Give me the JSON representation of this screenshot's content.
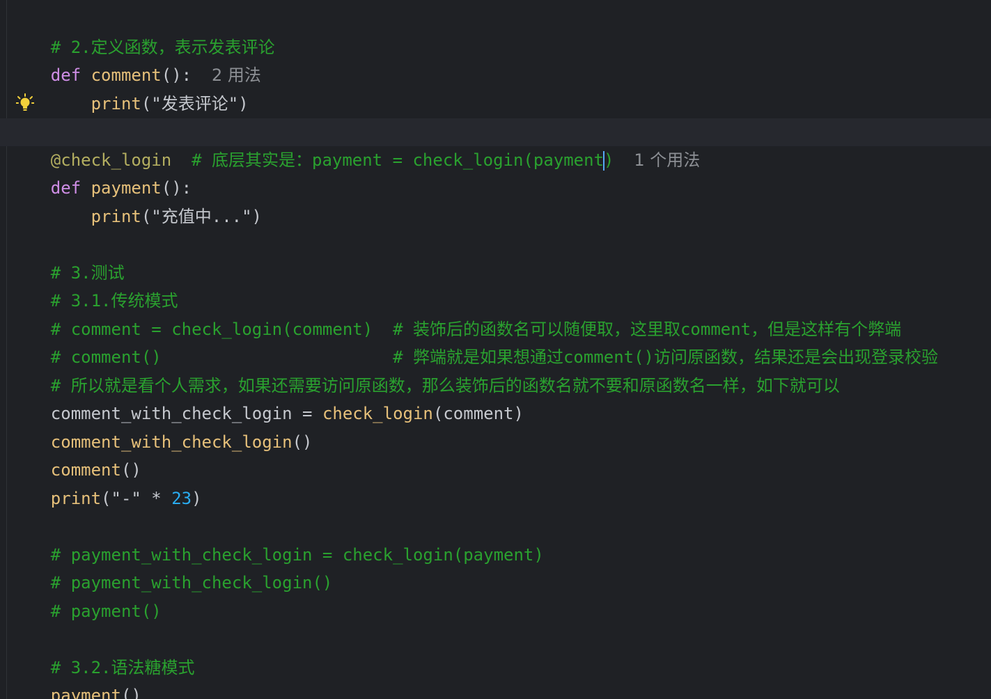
{
  "editor": {
    "lines": [
      {
        "comment": "# 2.定义函数，表示发表评论"
      },
      {
        "kw": "def",
        "name": "comment",
        "paren": "():",
        "hint": "2 用法"
      },
      {
        "indent": "    ",
        "call": "print",
        "open": "(",
        "str": "\"发表评论\"",
        "close": ")"
      },
      {},
      {
        "decorator": "@check_login",
        "gap": "  ",
        "comment_a": "# 底层其实是：payment = check_login(payment",
        "comment_b": ")",
        "hint": "1 个用法"
      },
      {
        "kw": "def",
        "name": "payment",
        "paren": "():"
      },
      {
        "indent": "    ",
        "call": "print",
        "open": "(",
        "str": "\"充值中...\"",
        "close": ")"
      },
      {},
      {
        "comment": "# 3.测试"
      },
      {
        "comment": "# 3.1.传统模式"
      },
      {
        "comment": "# comment = check_login(comment)  # 装饰后的函数名可以随便取，这里取comment，但是这样有个弊端"
      },
      {
        "comment": "# comment()                       # 弊端就是如果想通过comment()访问原函数，结果还是会出现登录校验"
      },
      {
        "comment": "# 所以就是看个人需求，如果还需要访问原函数，那么装饰后的函数名就不要和原函数名一样，如下就可以"
      },
      {
        "var": "comment_with_check_login",
        "op": " = ",
        "call": "check_login",
        "open": "(",
        "arg": "comment",
        "close": ")"
      },
      {
        "call": "comment_with_check_login",
        "parens": "()"
      },
      {
        "call": "comment",
        "parens": "()"
      },
      {
        "call": "print",
        "open": "(",
        "str": "\"-\"",
        "op": " * ",
        "num": "23",
        "close": ")"
      },
      {},
      {
        "comment": "# payment_with_check_login = check_login(payment)"
      },
      {
        "comment": "# payment_with_check_login()"
      },
      {
        "comment": "# payment()"
      },
      {},
      {
        "comment": "# 3.2.语法糖模式"
      },
      {
        "call": "payment",
        "parens": "()"
      }
    ]
  },
  "icons": {
    "intention": "lightbulb-icon"
  },
  "colors": {
    "background": "#1f2125",
    "current_line": "#26282e",
    "comment": "#2aa12f",
    "keyword": "#cf8ee6",
    "function_call": "#e6c07a",
    "number": "#2aacf0",
    "caret": "#56a8f5"
  }
}
